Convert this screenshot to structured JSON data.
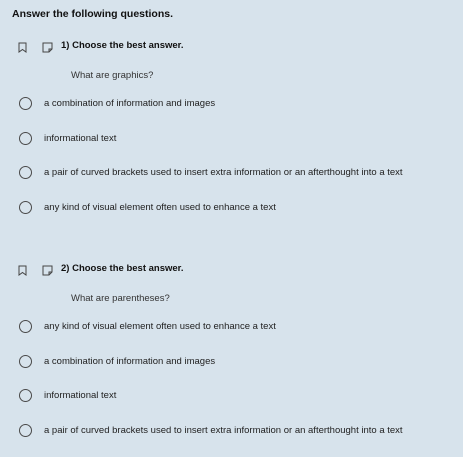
{
  "header": "Answer the following questions.",
  "questions": [
    {
      "title": "1) Choose the best answer.",
      "prompt": "What are graphics?",
      "options": [
        "a combination of information and images",
        "informational text",
        "a pair of curved brackets used to insert extra information or an afterthought into a text",
        "any kind of visual element often used to enhance a text"
      ]
    },
    {
      "title": "2) Choose the best answer.",
      "prompt": "What are parentheses?",
      "options": [
        "any kind of visual element often used to enhance a text",
        "a combination of information and images",
        "informational text",
        "a pair of curved brackets used to insert extra information or an afterthought into a text"
      ]
    }
  ]
}
